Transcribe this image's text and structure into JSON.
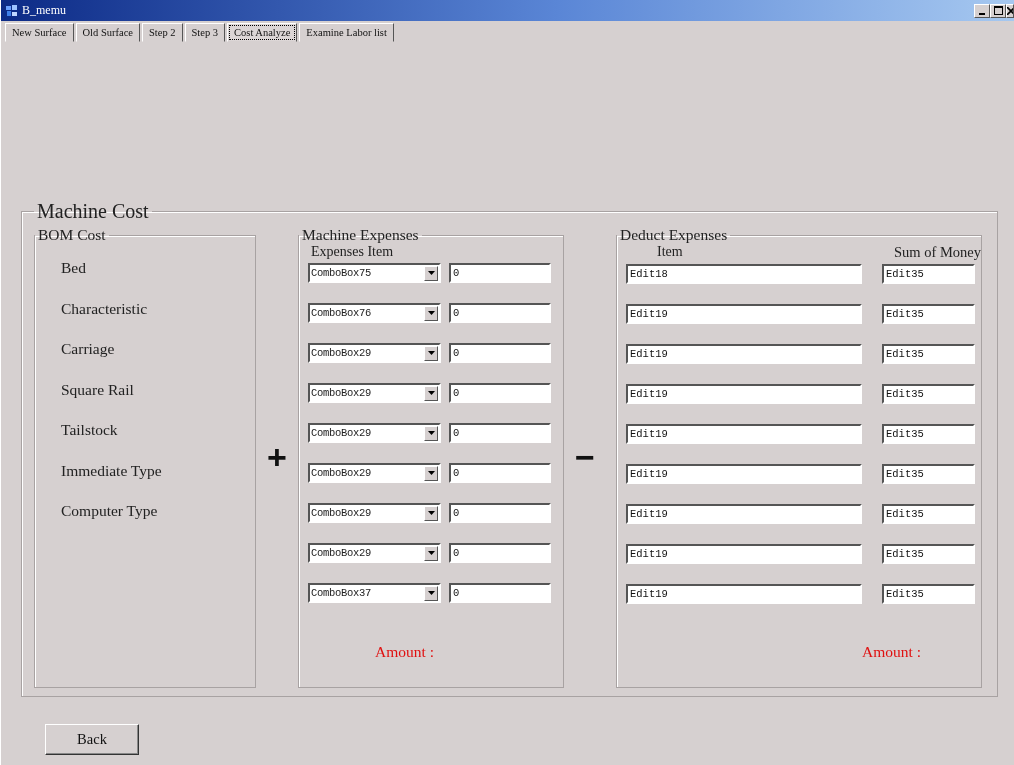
{
  "window": {
    "title": "B_memu"
  },
  "tabs": [
    {
      "label": "New Surface",
      "selected": false
    },
    {
      "label": "Old Surface",
      "selected": false
    },
    {
      "label": "Step 2",
      "selected": false
    },
    {
      "label": "Step 3",
      "selected": false
    },
    {
      "label": "Cost Analyze",
      "selected": true
    },
    {
      "label": "Examine Labor list",
      "selected": false
    }
  ],
  "machine_cost": {
    "title": "Machine Cost",
    "bom_cost": {
      "title": "BOM Cost",
      "items": [
        "Bed",
        "Characteristic",
        "Carriage",
        "Square  Rail",
        "Tailstock",
        "Immediate Type",
        "Computer Type"
      ]
    },
    "plus_sign": "+",
    "machine_expenses": {
      "title": "Machine Expenses",
      "column_header": "Expenses Item",
      "amount_label": "Amount :",
      "rows": [
        {
          "combo": "ComboBox75",
          "value": "0"
        },
        {
          "combo": "ComboBox76",
          "value": "0"
        },
        {
          "combo": "ComboBox29",
          "value": "0"
        },
        {
          "combo": "ComboBox29",
          "value": "0"
        },
        {
          "combo": "ComboBox29",
          "value": "0"
        },
        {
          "combo": "ComboBox29",
          "value": "0"
        },
        {
          "combo": "ComboBox29",
          "value": "0"
        },
        {
          "combo": "ComboBox29",
          "value": "0"
        },
        {
          "combo": "ComboBox37",
          "value": "0"
        }
      ]
    },
    "minus_sign": "−",
    "deduct_expenses": {
      "title": "Deduct Expenses",
      "item_header": "Item",
      "sum_header": "Sum of Money",
      "amount_label": "Amount :",
      "rows": [
        {
          "item": "Edit18",
          "sum": "Edit35"
        },
        {
          "item": "Edit19",
          "sum": "Edit35"
        },
        {
          "item": "Edit19",
          "sum": "Edit35"
        },
        {
          "item": "Edit19",
          "sum": "Edit35"
        },
        {
          "item": "Edit19",
          "sum": "Edit35"
        },
        {
          "item": "Edit19",
          "sum": "Edit35"
        },
        {
          "item": "Edit19",
          "sum": "Edit35"
        },
        {
          "item": "Edit19",
          "sum": "Edit35"
        },
        {
          "item": "Edit19",
          "sum": "Edit35"
        }
      ]
    }
  },
  "buttons": [
    "Back"
  ]
}
